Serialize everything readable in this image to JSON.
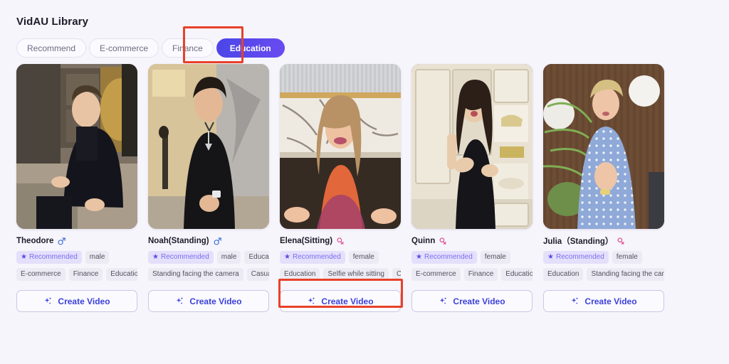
{
  "header": {
    "title": "VidAU Library"
  },
  "tabs": [
    {
      "label": "Recommend",
      "active": false
    },
    {
      "label": "E-commerce",
      "active": false
    },
    {
      "label": "Finance",
      "active": false
    },
    {
      "label": "Education",
      "active": true
    }
  ],
  "cta_label": "Create Video",
  "badge_label": "Recommended",
  "colors": {
    "background": "#f6f5fc",
    "accent": "#4a46e8",
    "accent_gradient_end": "#6a4bf0",
    "highlight_box": "#e8412a",
    "badge_bg": "#e4e0fb",
    "badge_text": "#7d6ef0",
    "tag_bg": "#ecebf3",
    "tag_text": "#52525f",
    "male_icon": "#3b6fd4",
    "female_icon": "#e0468c",
    "cta_text": "#3b41d8",
    "card_border": "#c9c8e4"
  },
  "cards": [
    {
      "name": "Theodore",
      "gender": "male",
      "gender_icon": "male-icon",
      "tags_row1": [
        "Recommended",
        "male"
      ],
      "tags_row2": [
        "E-commerce",
        "Finance",
        "Education"
      ],
      "thumb": {
        "alt": "young man in dark suit seated in modern room",
        "bg_top": "#6a5f52",
        "bg_mid": "#8b7a63",
        "bg_bottom": "#b9ae9d",
        "subject": "#14141c",
        "skin": "#e8c4a4",
        "hair": "#4a3a2a"
      }
    },
    {
      "name": "Noah(Standing)",
      "gender": "male",
      "gender_icon": "male-icon",
      "tags_row1": [
        "Recommended",
        "male",
        "Education"
      ],
      "tags_row2": [
        "Standing facing the camera",
        "Casual"
      ],
      "thumb": {
        "alt": "young man in black sleeveless top standing in lobby",
        "bg_top": "#d9c79a",
        "bg_mid": "#c9bca6",
        "bg_bottom": "#b2aba2",
        "subject": "#151517",
        "skin": "#e4b894",
        "hair": "#221a14"
      }
    },
    {
      "name": "Elena(Sitting)",
      "gender": "female",
      "gender_icon": "female-icon",
      "tags_row1": [
        "Recommended",
        "female"
      ],
      "tags_row2": [
        "Education",
        "Selfie while sitting",
        "Casual"
      ],
      "thumb": {
        "alt": "smiling blonde woman in orange top in marble kitchen",
        "bg_top": "#d6d8da",
        "bg_mid": "#e9e4dc",
        "bg_bottom": "#3b2f27",
        "subject": "#e2673a",
        "skin": "#eec1a0",
        "hair": "#b89265"
      }
    },
    {
      "name": "Quinn",
      "gender": "female",
      "gender_icon": "female-icon",
      "tags_row1": [
        "Recommended",
        "female"
      ],
      "tags_row2": [
        "E-commerce",
        "Finance",
        "Education"
      ],
      "thumb": {
        "alt": "woman in black dress standing before white cabinetry",
        "bg_top": "#ece6da",
        "bg_mid": "#e3dccc",
        "bg_bottom": "#ded6c6",
        "subject": "#15151a",
        "skin": "#e8cbab",
        "hair": "#2b1f18"
      }
    },
    {
      "name": "Julia（Standing）",
      "gender": "female",
      "gender_icon": "female-icon",
      "tags_row1": [
        "Recommended",
        "female"
      ],
      "tags_row2": [
        "Education",
        "Standing facing the camera"
      ],
      "thumb": {
        "alt": "blonde woman in blue polka dot dress with plants",
        "bg_top": "#6b4a33",
        "bg_mid": "#7a563a",
        "bg_bottom": "#6a4a33",
        "subject": "#8fa9d8",
        "skin": "#eec5a6",
        "hair": "#d6bf82"
      }
    }
  ],
  "highlights": [
    {
      "name": "education-tab-highlight",
      "target": "tab-education"
    },
    {
      "name": "create-video-highlight",
      "target": "card-3-create-video"
    }
  ]
}
